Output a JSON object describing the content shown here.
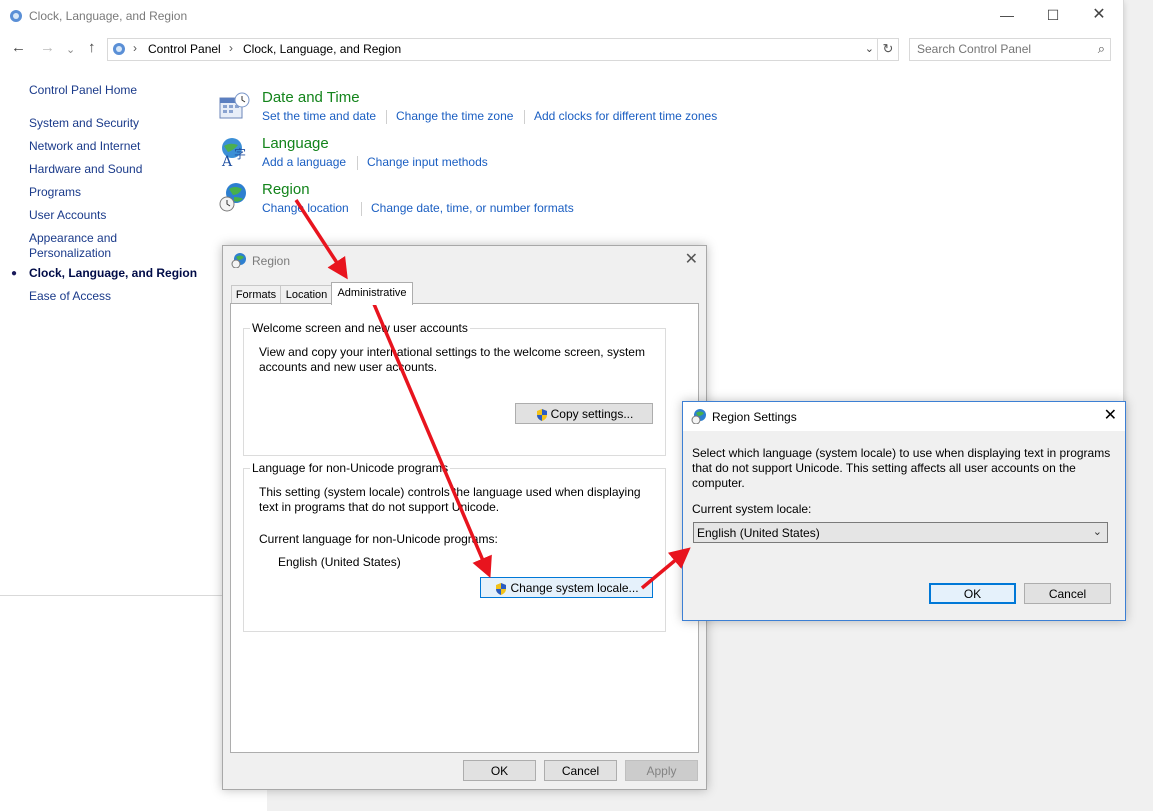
{
  "window": {
    "title": "Clock, Language, and Region"
  },
  "toolbar": {
    "back": "←",
    "forward": "→",
    "recent": "⌄",
    "up": "↑"
  },
  "address": {
    "crumbs": [
      "Control Panel",
      "Clock, Language, and Region"
    ],
    "search_placeholder": "Search Control Panel"
  },
  "sidebar": {
    "home": "Control Panel Home",
    "items": [
      "System and Security",
      "Network and Internet",
      "Hardware and Sound",
      "Programs",
      "User Accounts",
      "Appearance and Personalization",
      "Clock, Language, and Region",
      "Ease of Access"
    ],
    "current_index": 6
  },
  "categories": {
    "datetime": {
      "title": "Date and Time",
      "links": [
        "Set the time and date",
        "Change the time zone",
        "Add clocks for different time zones"
      ]
    },
    "language": {
      "title": "Language",
      "links": [
        "Add a language",
        "Change input methods"
      ]
    },
    "region": {
      "title": "Region",
      "links": [
        "Change location",
        "Change date, time, or number formats"
      ]
    }
  },
  "region_dialog": {
    "title": "Region",
    "tabs": [
      "Formats",
      "Location",
      "Administrative"
    ],
    "active_tab": "Administrative",
    "welcome_group": {
      "label": "Welcome screen and new user accounts",
      "text": "View and copy your international settings to the welcome screen, system accounts and new user accounts.",
      "button": "Copy settings..."
    },
    "unicode_group": {
      "label": "Language for non-Unicode programs",
      "text": "This setting (system locale) controls the language used when displaying text in programs that do not support Unicode.",
      "current_label": "Current language for non-Unicode programs:",
      "current_value": "English (United States)",
      "button": "Change system locale..."
    },
    "buttons": {
      "ok": "OK",
      "cancel": "Cancel",
      "apply": "Apply"
    }
  },
  "region_settings_dialog": {
    "title": "Region Settings",
    "description": "Select which language (system locale) to use when displaying text in programs that do not support Unicode. This setting affects all user accounts on the computer.",
    "locale_label": "Current system locale:",
    "locale_value": "English (United States)",
    "buttons": {
      "ok": "OK",
      "cancel": "Cancel"
    }
  },
  "colors": {
    "link": "#1a5ec2",
    "category_title": "#13841b",
    "annotation_arrow": "#e8141e",
    "focus_border": "#0078d7"
  }
}
